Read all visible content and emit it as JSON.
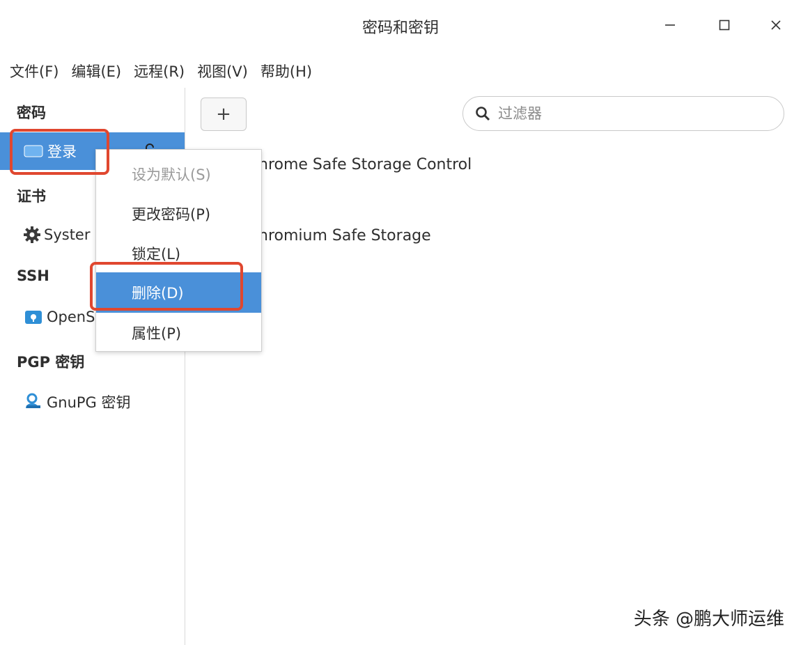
{
  "window": {
    "title": "密码和密钥"
  },
  "menubar": [
    "文件(F)",
    "编辑(E)",
    "远程(R)",
    "视图(V)",
    "帮助(H)"
  ],
  "sidebar": {
    "sections": [
      {
        "header": "密码",
        "items": [
          {
            "label": "登录",
            "icon": "login-keyring-icon",
            "selected": true
          }
        ]
      },
      {
        "header": "证书",
        "items": [
          {
            "label": "Syster",
            "icon": "gear-icon"
          }
        ]
      },
      {
        "header": "SSH",
        "items": [
          {
            "label": "OpenS",
            "icon": "folder-key-icon"
          }
        ]
      },
      {
        "header": "PGP 密钥",
        "items": [
          {
            "label": "GnuPG 密钥",
            "icon": "person-key-icon"
          }
        ]
      }
    ]
  },
  "toolbar": {
    "add_label": "+"
  },
  "search": {
    "placeholder": "过滤器"
  },
  "entries": [
    "hrome Safe Storage Control",
    "hromium Safe Storage"
  ],
  "context_menu": {
    "items": [
      {
        "label": "设为默认(S)",
        "disabled": true
      },
      {
        "label": "更改密码(P)"
      },
      {
        "label": "锁定(L)"
      },
      {
        "label": "删除(D)",
        "highlighted": true
      },
      {
        "label": "属性(P)"
      }
    ]
  },
  "watermark": "头条 @鹏大师运维",
  "colors": {
    "selection": "#4a90d9",
    "annotation": "#e0472f"
  }
}
